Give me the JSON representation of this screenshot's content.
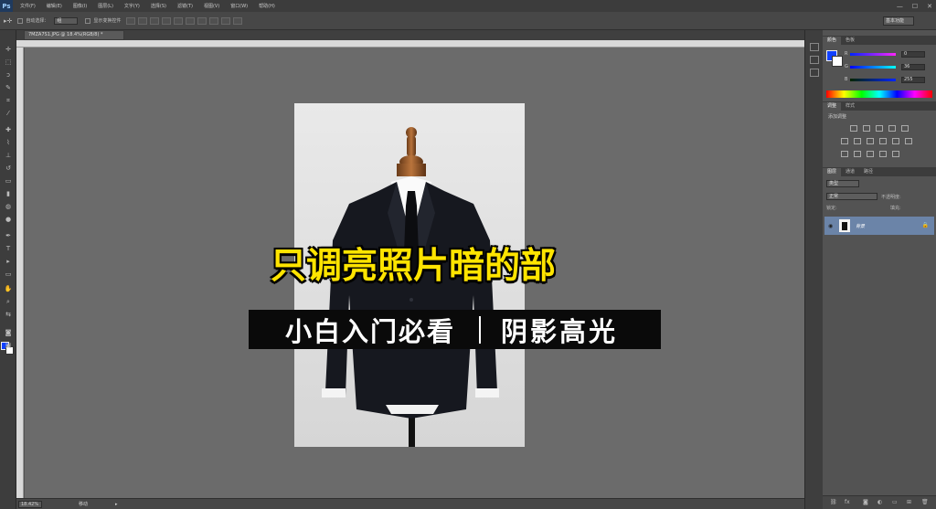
{
  "app": {
    "logo": "Ps"
  },
  "menu": [
    "文件(F)",
    "编辑(E)",
    "图像(I)",
    "图层(L)",
    "文字(Y)",
    "选择(S)",
    "滤镜(T)",
    "视图(V)",
    "窗口(W)",
    "帮助(H)"
  ],
  "window_controls": {
    "minimize": "—",
    "maximize": "☐",
    "close": "✕"
  },
  "options_bar": {
    "auto_select_label": "自动选择：",
    "auto_select_value": "组",
    "show_transform_label": "显示变换控件",
    "workspace": "基本功能"
  },
  "document": {
    "tab_title": "7MZA7S1.JPG @ 18.4%(RGB/8) *"
  },
  "status": {
    "zoom": "18.42%",
    "info": "移动"
  },
  "overlay": {
    "title": "只调亮照片暗的部",
    "subtitle_left": "小白入门必看",
    "subtitle_right": "阴影高光"
  },
  "panels": {
    "color_tabs": [
      "颜色",
      "色板"
    ],
    "channels": [
      {
        "label": "R",
        "value": "0"
      },
      {
        "label": "G",
        "value": "36"
      },
      {
        "label": "B",
        "value": "255"
      }
    ],
    "adjust_tabs": [
      "调整",
      "样式"
    ],
    "adjust_title": "添加调整",
    "layer_tabs": [
      "图层",
      "通道",
      "路径"
    ],
    "layer_kind": "类型",
    "layer_mode": "正常",
    "opacity_label": "不透明度:",
    "lock_label": "锁定:",
    "fill_label": "填充:",
    "layers": [
      {
        "name": "背景"
      }
    ]
  },
  "colors": {
    "foreground": "#1040ff",
    "background": "#ffffff",
    "title_yellow": "#ffe400",
    "layer_selected": "#6b84a8"
  }
}
